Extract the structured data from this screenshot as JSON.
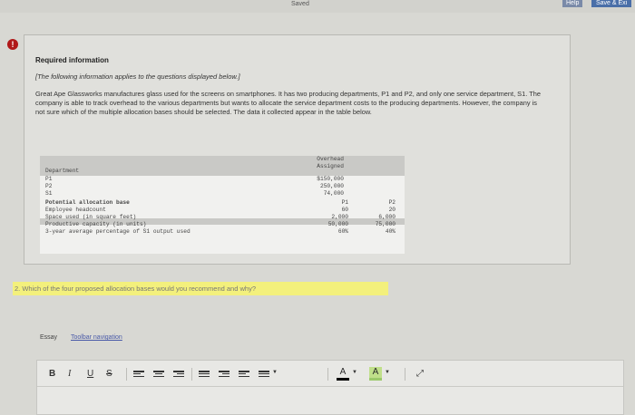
{
  "header": {
    "saved": "Saved",
    "help": "Help",
    "save_exit": "Save & Exi"
  },
  "alert_icon": "!",
  "info": {
    "title": "Required information",
    "note": "[The following information applies to the questions displayed below.]",
    "intro": "Great Ape Glassworks manufactures glass used for the screens on smartphones. It has two producing departments, P1 and P2, and only one service department, S1. The company is able to track overhead to the various departments but wants to allocate the service department costs to the producing departments. However, the company is not sure which of the multiple allocation bases should be selected. The data it collected appear in the table below."
  },
  "table": {
    "overhead_header": [
      "Overhead",
      "Assigned"
    ],
    "department_label": "Department",
    "departments": [
      {
        "name": "P1",
        "overhead": "$150,000"
      },
      {
        "name": "P2",
        "overhead": "250,000"
      },
      {
        "name": "S1",
        "overhead": "74,000"
      }
    ],
    "base_label": "Potential allocation base",
    "p1_header": "P1",
    "p2_header": "P2",
    "bases": [
      {
        "name": "Employee headcount",
        "p1": "60",
        "p2": "20"
      },
      {
        "name": "Space used (in square feet)",
        "p1": "2,000",
        "p2": "6,000"
      },
      {
        "name": "Productive capacity (in units)",
        "p1": "50,000",
        "p2": "75,000"
      },
      {
        "name": "3-year average percentage of S1 output used",
        "p1": "60%",
        "p2": "40%"
      }
    ]
  },
  "question": {
    "text": "2. Which of the four proposed allocation bases would you recommend and why?"
  },
  "essay": {
    "label": "Essay",
    "toolbar_nav": "Toolbar navigation"
  },
  "editor": {
    "bold": "B",
    "italic": "I",
    "underline": "U",
    "strike": "S",
    "font_color": "A",
    "bg_color": "A",
    "dropdown": "▼",
    "expand": "⤢"
  }
}
